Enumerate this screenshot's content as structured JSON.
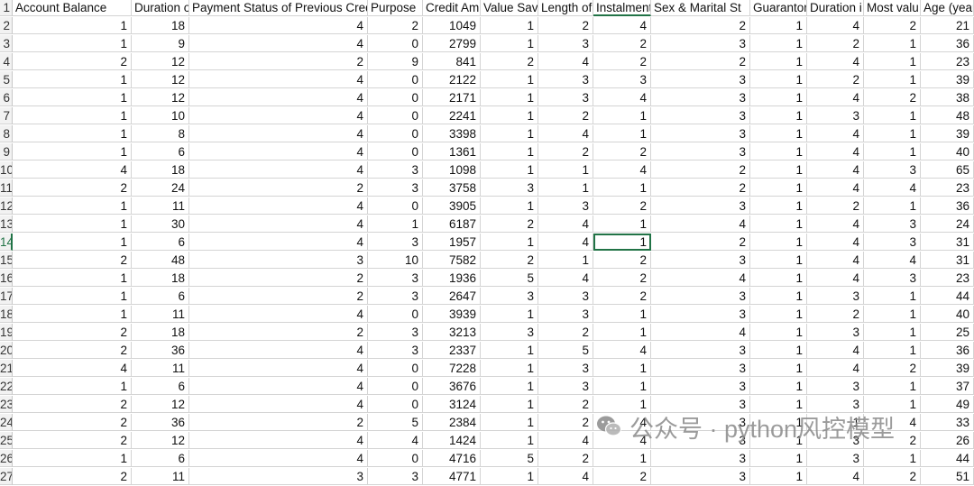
{
  "columns": [
    "Account Balance",
    "Duration o",
    "Payment Status of Previous Credi",
    "Purpose",
    "Credit Am",
    "Value Savi",
    "Length of",
    "Instalment",
    "Sex & Marital St",
    "Guarantor",
    "Duration i",
    "Most valu",
    "Age (year"
  ],
  "row_numbers": [
    "1",
    "2",
    "3",
    "4",
    "5",
    "6",
    "7",
    "8",
    "9",
    "10",
    "11",
    "12",
    "13",
    "14",
    "15",
    "16",
    "17",
    "18",
    "19",
    "20",
    "21",
    "22",
    "23",
    "24",
    "25",
    "26",
    "27"
  ],
  "rows": [
    [
      "1",
      "18",
      "4",
      "2",
      "1049",
      "1",
      "2",
      "4",
      "2",
      "1",
      "4",
      "2",
      "21"
    ],
    [
      "1",
      "9",
      "4",
      "0",
      "2799",
      "1",
      "3",
      "2",
      "3",
      "1",
      "2",
      "1",
      "36"
    ],
    [
      "2",
      "12",
      "2",
      "9",
      "841",
      "2",
      "4",
      "2",
      "2",
      "1",
      "4",
      "1",
      "23"
    ],
    [
      "1",
      "12",
      "4",
      "0",
      "2122",
      "1",
      "3",
      "3",
      "3",
      "1",
      "2",
      "1",
      "39"
    ],
    [
      "1",
      "12",
      "4",
      "0",
      "2171",
      "1",
      "3",
      "4",
      "3",
      "1",
      "4",
      "2",
      "38"
    ],
    [
      "1",
      "10",
      "4",
      "0",
      "2241",
      "1",
      "2",
      "1",
      "3",
      "1",
      "3",
      "1",
      "48"
    ],
    [
      "1",
      "8",
      "4",
      "0",
      "3398",
      "1",
      "4",
      "1",
      "3",
      "1",
      "4",
      "1",
      "39"
    ],
    [
      "1",
      "6",
      "4",
      "0",
      "1361",
      "1",
      "2",
      "2",
      "3",
      "1",
      "4",
      "1",
      "40"
    ],
    [
      "4",
      "18",
      "4",
      "3",
      "1098",
      "1",
      "1",
      "4",
      "2",
      "1",
      "4",
      "3",
      "65"
    ],
    [
      "2",
      "24",
      "2",
      "3",
      "3758",
      "3",
      "1",
      "1",
      "2",
      "1",
      "4",
      "4",
      "23"
    ],
    [
      "1",
      "11",
      "4",
      "0",
      "3905",
      "1",
      "3",
      "2",
      "3",
      "1",
      "2",
      "1",
      "36"
    ],
    [
      "1",
      "30",
      "4",
      "1",
      "6187",
      "2",
      "4",
      "1",
      "4",
      "1",
      "4",
      "3",
      "24"
    ],
    [
      "1",
      "6",
      "4",
      "3",
      "1957",
      "1",
      "4",
      "1",
      "2",
      "1",
      "4",
      "3",
      "31"
    ],
    [
      "2",
      "48",
      "3",
      "10",
      "7582",
      "2",
      "1",
      "2",
      "3",
      "1",
      "4",
      "4",
      "31"
    ],
    [
      "1",
      "18",
      "2",
      "3",
      "1936",
      "5",
      "4",
      "2",
      "4",
      "1",
      "4",
      "3",
      "23"
    ],
    [
      "1",
      "6",
      "2",
      "3",
      "2647",
      "3",
      "3",
      "2",
      "3",
      "1",
      "3",
      "1",
      "44"
    ],
    [
      "1",
      "11",
      "4",
      "0",
      "3939",
      "1",
      "3",
      "1",
      "3",
      "1",
      "2",
      "1",
      "40"
    ],
    [
      "2",
      "18",
      "2",
      "3",
      "3213",
      "3",
      "2",
      "1",
      "4",
      "1",
      "3",
      "1",
      "25"
    ],
    [
      "2",
      "36",
      "4",
      "3",
      "2337",
      "1",
      "5",
      "4",
      "3",
      "1",
      "4",
      "1",
      "36"
    ],
    [
      "4",
      "11",
      "4",
      "0",
      "7228",
      "1",
      "3",
      "1",
      "3",
      "1",
      "4",
      "2",
      "39"
    ],
    [
      "1",
      "6",
      "4",
      "0",
      "3676",
      "1",
      "3",
      "1",
      "3",
      "1",
      "3",
      "1",
      "37"
    ],
    [
      "2",
      "12",
      "4",
      "0",
      "3124",
      "1",
      "2",
      "1",
      "3",
      "1",
      "3",
      "1",
      "49"
    ],
    [
      "2",
      "36",
      "2",
      "5",
      "2384",
      "1",
      "2",
      "4",
      "3",
      "1",
      "1",
      "4",
      "33"
    ],
    [
      "2",
      "12",
      "4",
      "4",
      "1424",
      "1",
      "4",
      "4",
      "3",
      "1",
      "3",
      "2",
      "26"
    ],
    [
      "1",
      "6",
      "4",
      "0",
      "4716",
      "5",
      "2",
      "1",
      "3",
      "1",
      "3",
      "1",
      "44"
    ],
    [
      "2",
      "11",
      "3",
      "3",
      "4771",
      "1",
      "4",
      "2",
      "3",
      "1",
      "4",
      "2",
      "51"
    ]
  ],
  "active_cell": {
    "row": "14",
    "column": "Instalment",
    "value": "1"
  },
  "watermark": {
    "text": "公众号 · python风控模型",
    "icon": "wechat-icon"
  }
}
